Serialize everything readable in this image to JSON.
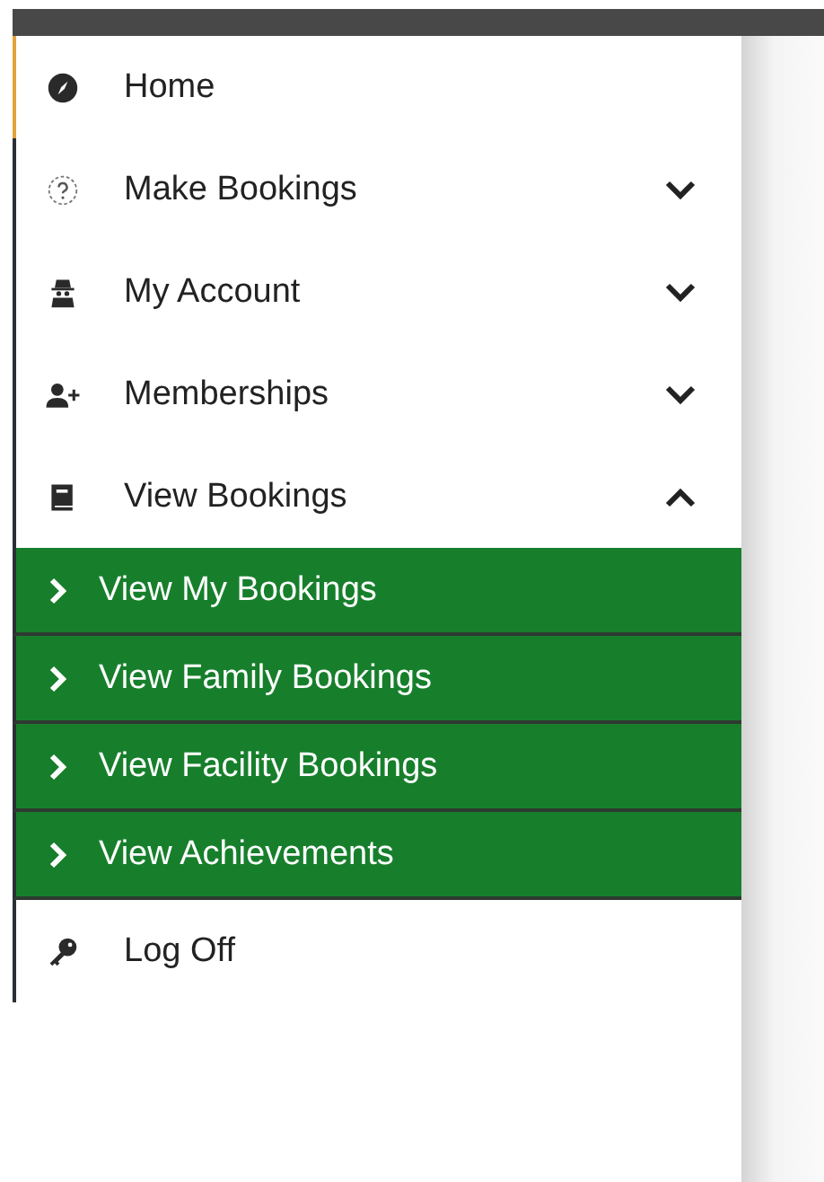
{
  "menu": {
    "items": [
      {
        "label": "Home",
        "kind": "link",
        "selected": true
      },
      {
        "label": "Make Bookings",
        "kind": "group",
        "expanded": false,
        "selected": false
      },
      {
        "label": "My Account",
        "kind": "group",
        "expanded": false,
        "selected": false
      },
      {
        "label": "Memberships",
        "kind": "group",
        "expanded": false,
        "selected": false
      },
      {
        "label": "View Bookings",
        "kind": "group",
        "expanded": true,
        "selected": false,
        "children": [
          {
            "label": "View My Bookings"
          },
          {
            "label": "View Family Bookings"
          },
          {
            "label": "View Facility Bookings"
          },
          {
            "label": "View Achievements"
          }
        ]
      },
      {
        "label": "Log Off",
        "kind": "link",
        "selected": false
      }
    ]
  }
}
